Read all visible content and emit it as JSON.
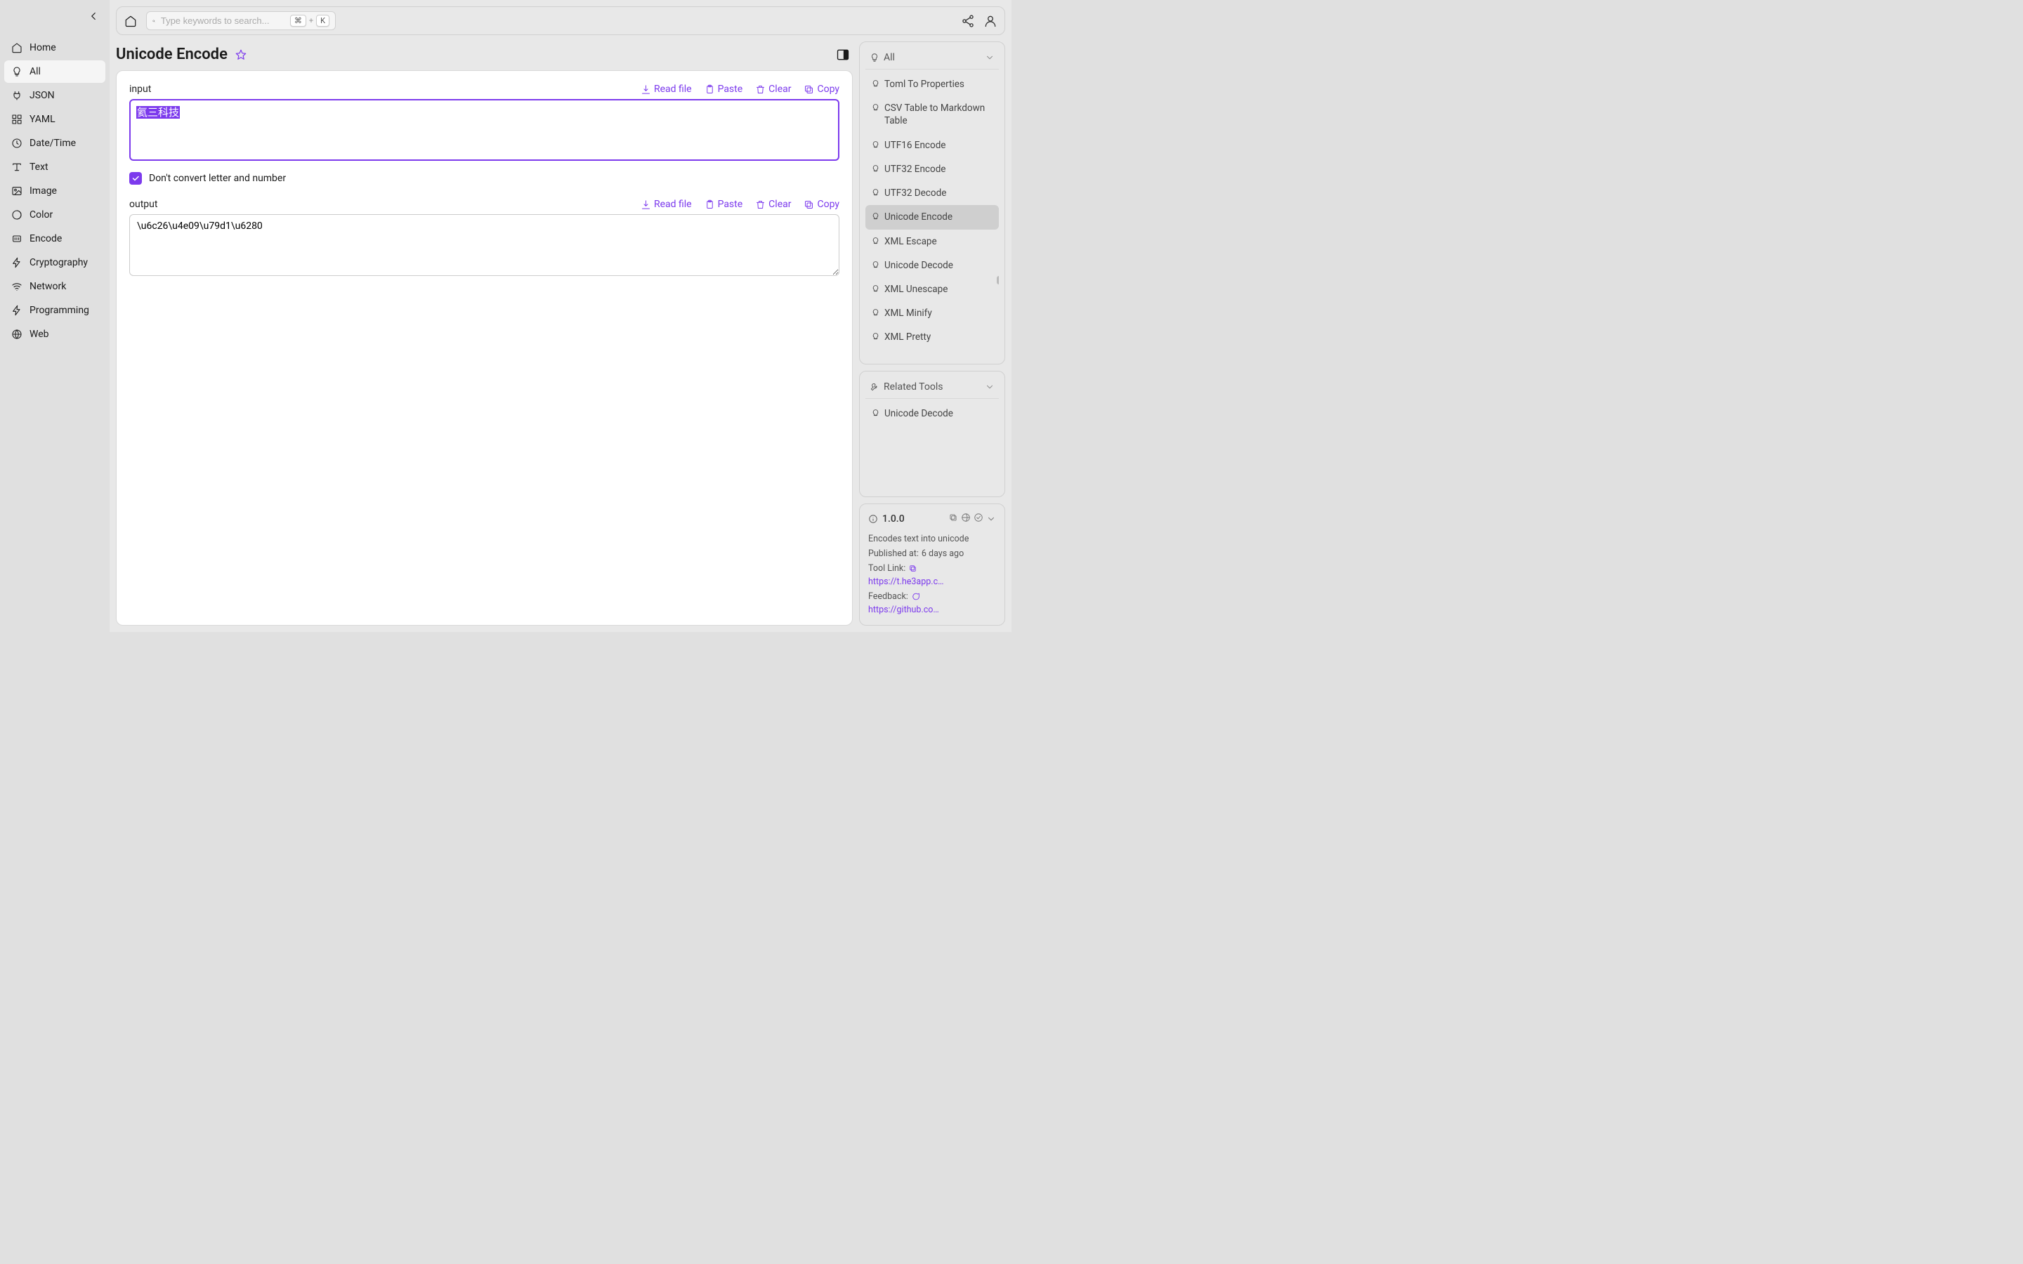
{
  "sidebar": {
    "items": [
      {
        "label": "Home"
      },
      {
        "label": "All"
      },
      {
        "label": "JSON"
      },
      {
        "label": "YAML"
      },
      {
        "label": "Date/Time"
      },
      {
        "label": "Text"
      },
      {
        "label": "Image"
      },
      {
        "label": "Color"
      },
      {
        "label": "Encode"
      },
      {
        "label": "Cryptography"
      },
      {
        "label": "Network"
      },
      {
        "label": "Programming"
      },
      {
        "label": "Web"
      }
    ],
    "active_index": 1
  },
  "search": {
    "placeholder": "Type keywords to search...",
    "shortcut_cmd": "⌘",
    "shortcut_plus": "+",
    "shortcut_key": "K"
  },
  "tool": {
    "title": "Unicode Encode",
    "input_label": "input",
    "input_value": "氦三科技",
    "checkbox_label": "Don't convert letter and number",
    "checkbox_checked": true,
    "output_label": "output",
    "output_value": "\\u6c26\\u4e09\\u79d1\\u6280",
    "actions": {
      "read_file": "Read file",
      "paste": "Paste",
      "clear": "Clear",
      "copy": "Copy"
    }
  },
  "right": {
    "all_header": "All",
    "tools": [
      {
        "label": "Toml To Properties"
      },
      {
        "label": "CSV Table to Markdown Table"
      },
      {
        "label": "UTF16 Encode"
      },
      {
        "label": "UTF32 Encode"
      },
      {
        "label": "UTF32 Decode"
      },
      {
        "label": "Unicode Encode"
      },
      {
        "label": "XML Escape"
      },
      {
        "label": "Unicode Decode"
      },
      {
        "label": "XML Unescape"
      },
      {
        "label": "XML Minify"
      },
      {
        "label": "XML Pretty"
      }
    ],
    "active_tool_index": 5,
    "related_header": "Related Tools",
    "related": [
      {
        "label": "Unicode Decode"
      }
    ]
  },
  "info": {
    "version": "1.0.0",
    "description": "Encodes text into unicode",
    "published_label": "Published at:",
    "published_value": "6 days ago",
    "tool_link_label": "Tool Link:",
    "tool_link_value": "https://t.he3app.co…",
    "feedback_label": "Feedback:",
    "feedback_value": "https://github.com/…"
  }
}
